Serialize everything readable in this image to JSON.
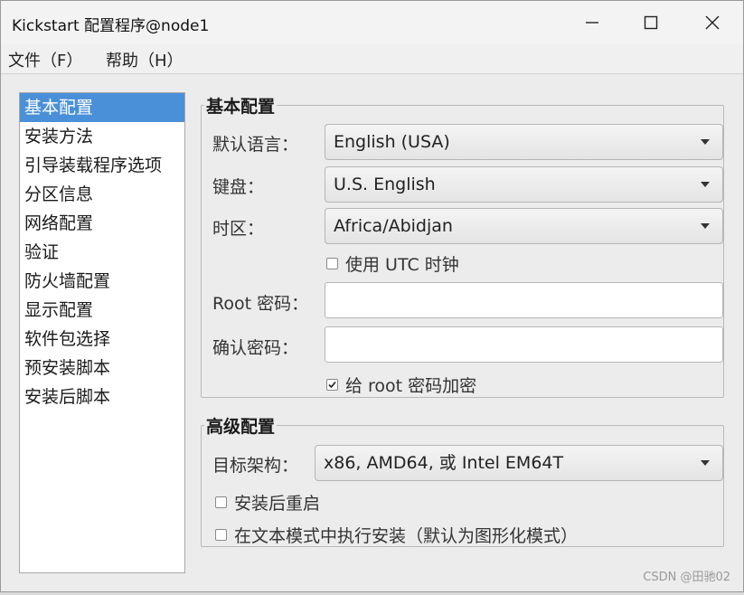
{
  "window": {
    "title": "Kickstart 配置程序@node1"
  },
  "menu": [
    {
      "label": "文件（F）"
    },
    {
      "label": "帮助（H）"
    }
  ],
  "nav": {
    "items": [
      {
        "label": "基本配置",
        "selected": true
      },
      {
        "label": "安装方法"
      },
      {
        "label": "引导装载程序选项"
      },
      {
        "label": "分区信息"
      },
      {
        "label": "网络配置"
      },
      {
        "label": "验证"
      },
      {
        "label": "防火墙配置"
      },
      {
        "label": "显示配置"
      },
      {
        "label": "软件包选择"
      },
      {
        "label": "预安装脚本"
      },
      {
        "label": "安装后脚本"
      }
    ]
  },
  "basic": {
    "title": "基本配置",
    "language_label": "默认语言：",
    "language_value": "English (USA)",
    "keyboard_label": "键盘：",
    "keyboard_value": "U.S. English",
    "timezone_label": "时区：",
    "timezone_value": "Africa/Abidjan",
    "utc_label": "使用 UTC 时钟",
    "utc_checked": false,
    "root_pw_label": "Root 密码：",
    "root_pw_value": "",
    "confirm_pw_label": "确认密码：",
    "confirm_pw_value": "",
    "encrypt_label": "给 root 密码加密",
    "encrypt_checked": true
  },
  "advanced": {
    "title": "高级配置",
    "arch_label": "目标架构：",
    "arch_value": "x86, AMD64, 或 Intel EM64T",
    "reboot_label": "安装后重启",
    "reboot_checked": false,
    "textmode_label": "在文本模式中执行安装（默认为图形化模式）",
    "textmode_checked": false
  },
  "watermark": "CSDN @田驰02",
  "colors": {
    "selection": "#4a90d9",
    "window_bg": "#ececec"
  }
}
